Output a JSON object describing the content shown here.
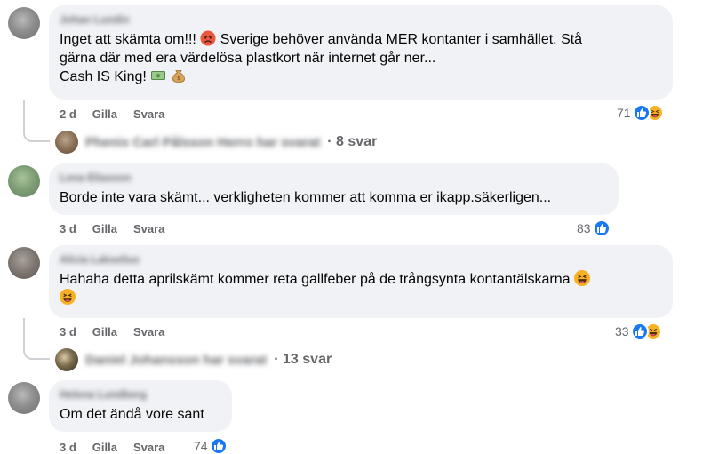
{
  "comments": [
    {
      "author": "Johan Lundin",
      "text_lines": [
        "Inget att skämta om!!! ",
        " Sverige behöver använda MER kontanter i samhället. Stå",
        "gärna där med era värdelösa plastkort när internet går ner...",
        "Cash IS King! "
      ],
      "time": "2 d",
      "like_label": "Gilla",
      "reply_label": "Svara",
      "reaction_count": "71",
      "replies": {
        "names": "Phenix Carl Pålsson Herro har svarat",
        "count": "· 8 svar"
      }
    },
    {
      "author": "Lena Eliasson",
      "text_lines": [
        "Borde inte vara skämt... verkligheten kommer att komma er ikapp.säkerligen..."
      ],
      "time": "3 d",
      "like_label": "Gilla",
      "reply_label": "Svara",
      "reaction_count": "83"
    },
    {
      "author": "Alicia Lakselius",
      "text_lines": [
        "Hahaha detta aprilskämt kommer reta gallfeber på de trångsynta kontantälskarna "
      ],
      "time": "3 d",
      "like_label": "Gilla",
      "reply_label": "Svara",
      "reaction_count": "33",
      "replies": {
        "names": "Daniel Johansson har svarat",
        "count": "· 13 svar"
      }
    },
    {
      "author": "Helena Lundberg",
      "text_lines": [
        "Om det ändå vore sant"
      ],
      "time": "3 d",
      "like_label": "Gilla",
      "reply_label": "Svara",
      "reaction_count": "74"
    }
  ],
  "icons": {
    "like": "like-reaction-icon",
    "haha": "haha-reaction-icon",
    "angry": "angry-emoji-icon",
    "money": "dollar-bill-emoji-icon",
    "moneybag": "money-bag-emoji-icon",
    "laugh": "laughing-emoji-icon"
  },
  "colors": {
    "bubble": "#f0f2f5",
    "like": "#1877f2",
    "haha": "#f7b125",
    "meta": "#65676b"
  }
}
